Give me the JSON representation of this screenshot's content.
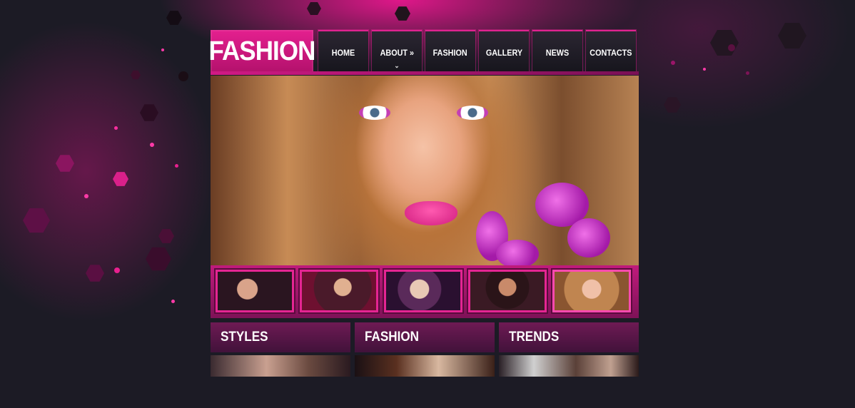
{
  "brand": {
    "logo_text": "FASHION"
  },
  "nav": {
    "items": [
      {
        "label": "HOME"
      },
      {
        "label": "ABOUT »",
        "caret": "⌄"
      },
      {
        "label": "FASHION"
      },
      {
        "label": "GALLERY"
      },
      {
        "label": "NEWS"
      },
      {
        "label": "CONTACTS"
      }
    ]
  },
  "sections": [
    {
      "title": "STYLES"
    },
    {
      "title": "FASHION"
    },
    {
      "title": "TRENDS"
    }
  ],
  "colors": {
    "accent": "#e4208f",
    "background": "#1c1b25",
    "nav_bg": "#1f1c24"
  }
}
